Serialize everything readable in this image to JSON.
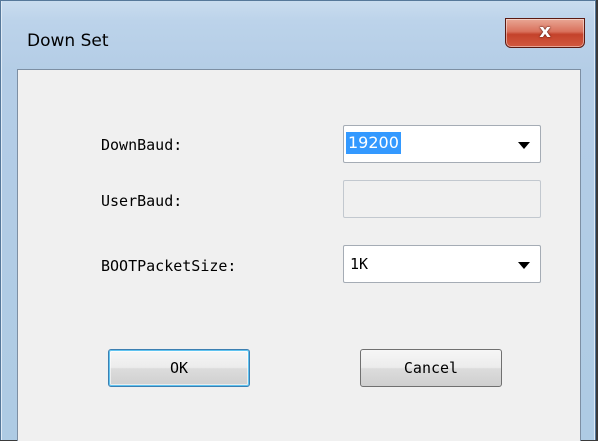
{
  "window": {
    "title": "Down Set",
    "close_glyph": "x",
    "close_icon": "close-icon"
  },
  "form": {
    "down_baud": {
      "label": "DownBaud:",
      "value": "19200",
      "arrow_icon": "chevron-down-icon"
    },
    "user_baud": {
      "label": "UserBaud:",
      "value": ""
    },
    "boot_packet_size": {
      "label": "BOOTPacketSize:",
      "value": "1K",
      "arrow_icon": "chevron-down-icon"
    }
  },
  "buttons": {
    "ok": "OK",
    "cancel": "Cancel"
  },
  "colors": {
    "selection": "#3399ff",
    "close_button": "#c4422b",
    "default_button_border": "#3c7fb1"
  }
}
